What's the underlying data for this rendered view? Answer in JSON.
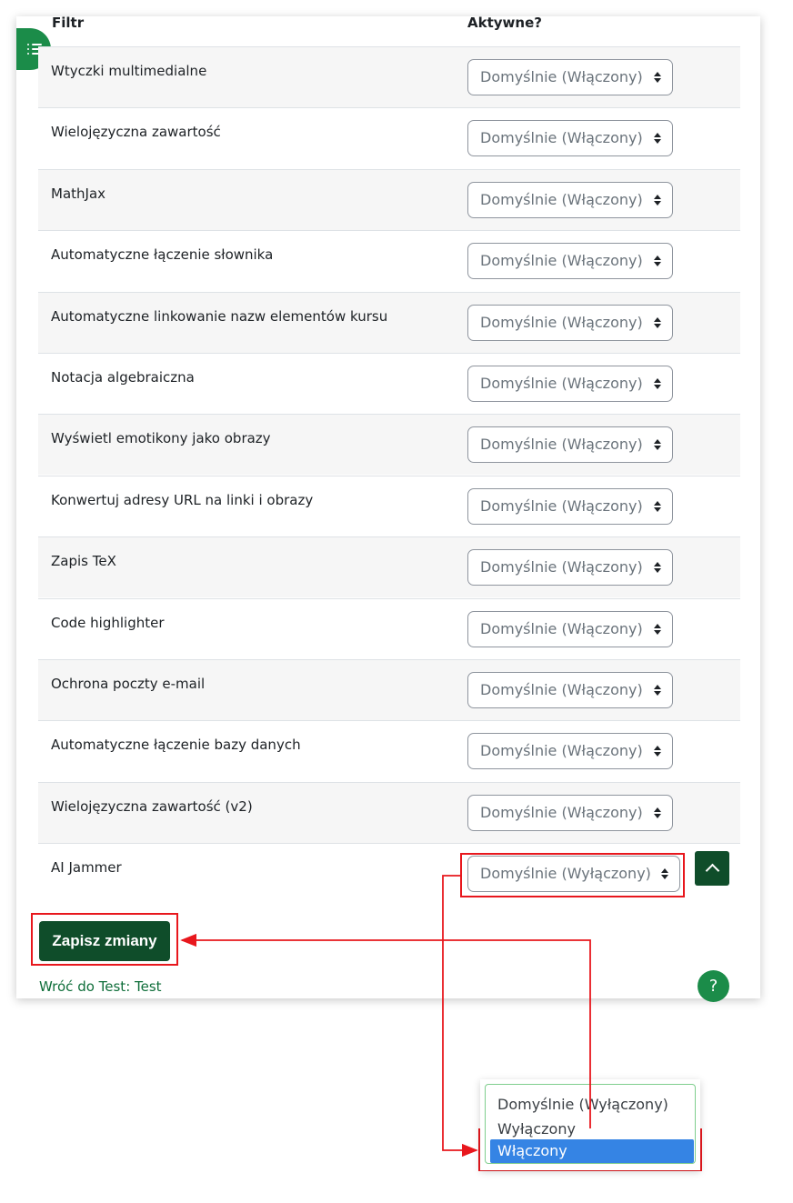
{
  "table": {
    "col_filter": "Filtr",
    "col_active": "Aktywne?",
    "rows": [
      {
        "label": "Wtyczki multimedialne",
        "value": "Domyślnie (Włączony)"
      },
      {
        "label": "Wielojęzyczna zawartość",
        "value": "Domyślnie (Włączony)"
      },
      {
        "label": "MathJax",
        "value": "Domyślnie (Włączony)"
      },
      {
        "label": "Automatyczne łączenie słownika",
        "value": "Domyślnie (Włączony)"
      },
      {
        "label": "Automatyczne linkowanie nazw elementów kursu",
        "value": "Domyślnie (Włączony)"
      },
      {
        "label": "Notacja algebraiczna",
        "value": "Domyślnie (Włączony)"
      },
      {
        "label": "Wyświetl emotikony jako obrazy",
        "value": "Domyślnie (Włączony)"
      },
      {
        "label": "Konwertuj adresy URL na linki i obrazy",
        "value": "Domyślnie (Włączony)"
      },
      {
        "label": "Zapis TeX",
        "value": "Domyślnie (Włączony)"
      },
      {
        "label": "Code highlighter",
        "value": "Domyślnie (Włączony)"
      },
      {
        "label": "Ochrona poczty e-mail",
        "value": "Domyślnie (Włączony)"
      },
      {
        "label": "Automatyczne łączenie bazy danych",
        "value": "Domyślnie (Włączony)"
      },
      {
        "label": "Wielojęzyczna zawartość (v2)",
        "value": "Domyślnie (Włączony)"
      },
      {
        "label": "AI Jammer",
        "value": "Domyślnie (Wyłączony)"
      }
    ]
  },
  "actions": {
    "save_label": "Zapisz zmiany",
    "back_link": "Wróć do Test: Test",
    "help_label": "?"
  },
  "dropdown": {
    "options": [
      "Domyślnie (Wyłączony)",
      "Wyłączony",
      "Włączony"
    ],
    "highlighted": "Włączony"
  },
  "icons": {
    "drawer": "list-icon",
    "back_to_top": "chevron-up-icon",
    "select_caret": "sort-caret-icon",
    "help": "question-icon"
  },
  "colors": {
    "primary": "#0f4d2a",
    "accent_green": "#1b8c49",
    "annotation_red": "#e8171d",
    "highlight_blue": "#3584e4"
  }
}
